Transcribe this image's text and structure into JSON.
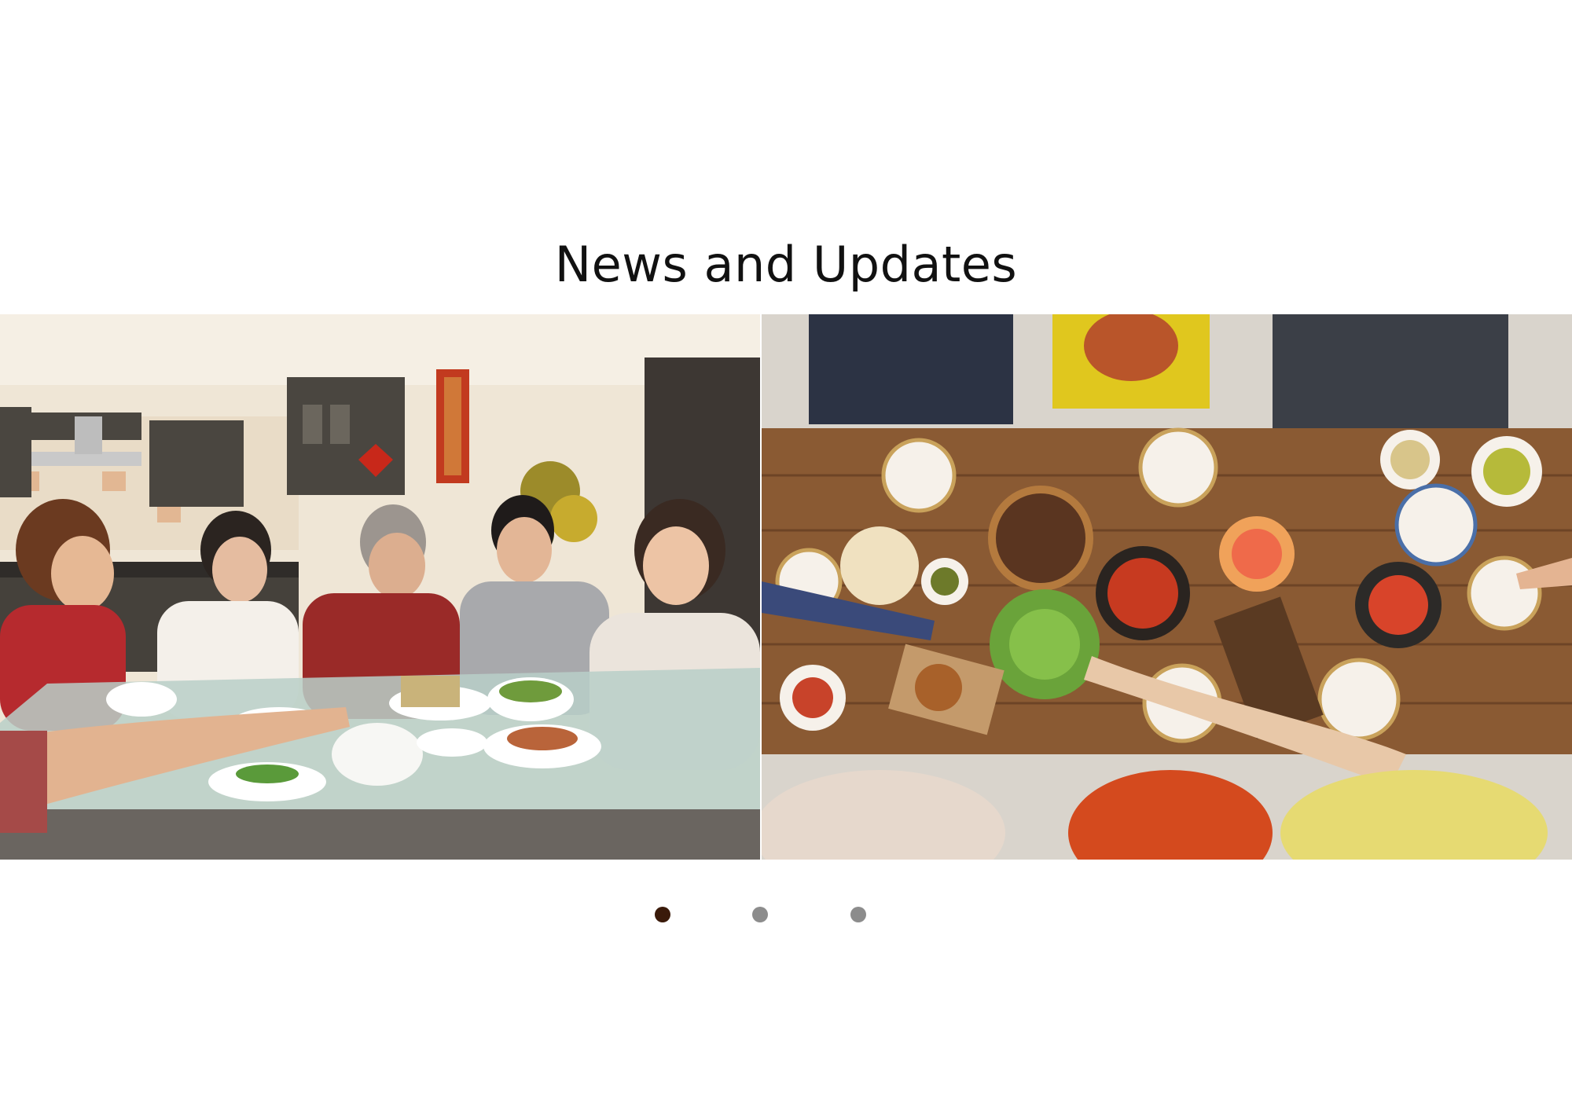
{
  "section": {
    "title": "News and Updates"
  },
  "carousel": {
    "active_index": 0,
    "dots": [
      {
        "state": "active"
      },
      {
        "state": "inactive"
      },
      {
        "state": "inactive"
      }
    ],
    "slides": [
      {
        "image": "family-dinner-photo"
      },
      {
        "image": "overhead-dinner-table-photo"
      }
    ]
  },
  "colors": {
    "dot_active": "#3a1a0a",
    "dot_inactive": "#8c8c8c",
    "title": "#111111"
  }
}
